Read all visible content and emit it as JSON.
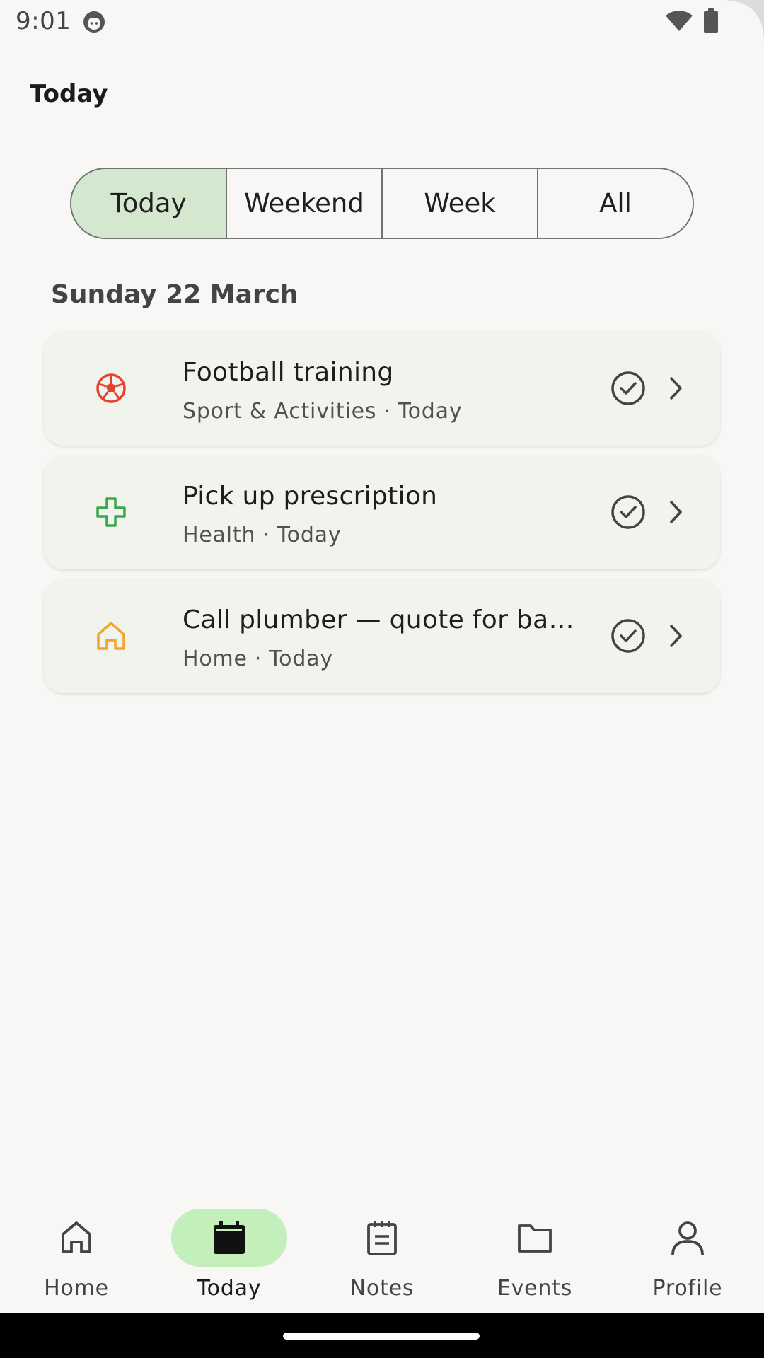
{
  "status_bar": {
    "time": "9:01"
  },
  "app_bar": {
    "title": "Today"
  },
  "filter_tabs": [
    {
      "label": "Today",
      "active": true
    },
    {
      "label": "Weekend",
      "active": false
    },
    {
      "label": "Week",
      "active": false
    },
    {
      "label": "All",
      "active": false
    }
  ],
  "section": {
    "date_heading": "Sunday 22 March"
  },
  "tasks": [
    {
      "title": "Football training",
      "category": "Sport & Activities",
      "when": "Today",
      "icon": "football-icon",
      "icon_color": "#e5412d"
    },
    {
      "title": "Pick up prescription",
      "category": "Health",
      "when": "Today",
      "icon": "medical-cross-icon",
      "icon_color": "#3aa84a"
    },
    {
      "title": "Call plumber — quote for bath…",
      "category": "Home",
      "when": "Today",
      "icon": "house-icon",
      "icon_color": "#f2a52a"
    }
  ],
  "task_separator": "·",
  "bottom_nav": [
    {
      "label": "Home",
      "icon": "home-icon",
      "active": false
    },
    {
      "label": "Today",
      "icon": "calendar-icon",
      "active": true
    },
    {
      "label": "Notes",
      "icon": "notes-icon",
      "active": false
    },
    {
      "label": "Events",
      "icon": "folder-icon",
      "active": false
    },
    {
      "label": "Profile",
      "icon": "person-icon",
      "active": false
    }
  ],
  "colors": {
    "background": "#f8f7f5",
    "card": "#f1f4ed",
    "active_tab": "#d4e8d0",
    "active_nav_pill": "#c2efba"
  }
}
